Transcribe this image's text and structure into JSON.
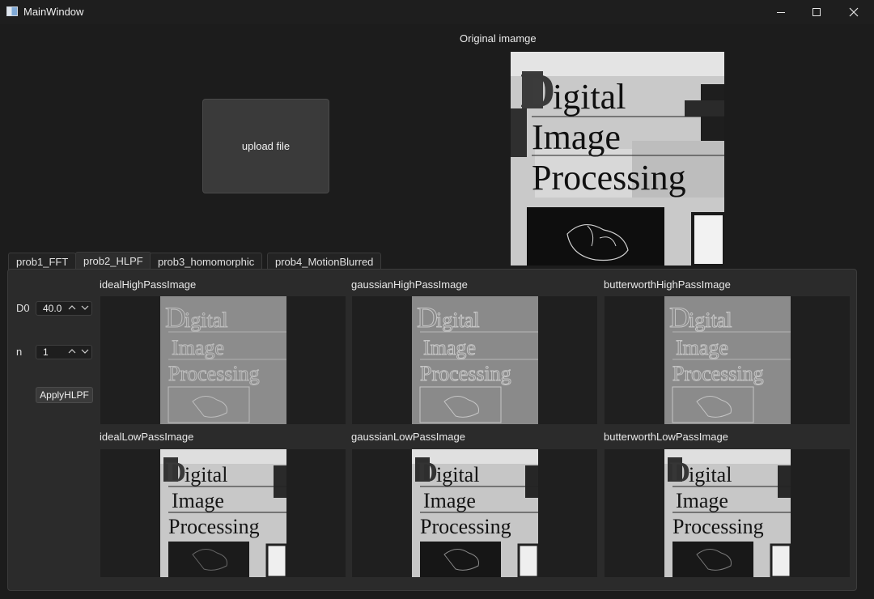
{
  "window": {
    "title": "MainWindow"
  },
  "upload": {
    "label": "upload file"
  },
  "original": {
    "label": "Original imamge",
    "art_lines": [
      "igital",
      "Image",
      "Processing"
    ],
    "art_initial": "D"
  },
  "tabs": [
    {
      "label": "prob1_FFT",
      "active": false
    },
    {
      "label": "prob2_HLPF",
      "active": true
    },
    {
      "label": "prob3_homomorphic",
      "active": false
    },
    {
      "label": "prob4_MotionBlurred",
      "active": false
    }
  ],
  "controls": {
    "d0_label": "D0",
    "d0_value": "40.0",
    "n_label": "n",
    "n_value": "1",
    "apply_label": "ApplyHLPF"
  },
  "results": {
    "ideal_high": "idealHighPassImage",
    "gaussian_high": "gaussianHighPassImage",
    "butterworth_high": "butterworthHighPassImage",
    "ideal_low": "idealLowPassImage",
    "gaussian_low": "gaussianLowPassImage",
    "butterworth_low": "butterworthLowPassImage"
  },
  "colors": {
    "background": "#1c1c1c",
    "panel": "#2b2b2b",
    "button": "#3a3a3a"
  }
}
